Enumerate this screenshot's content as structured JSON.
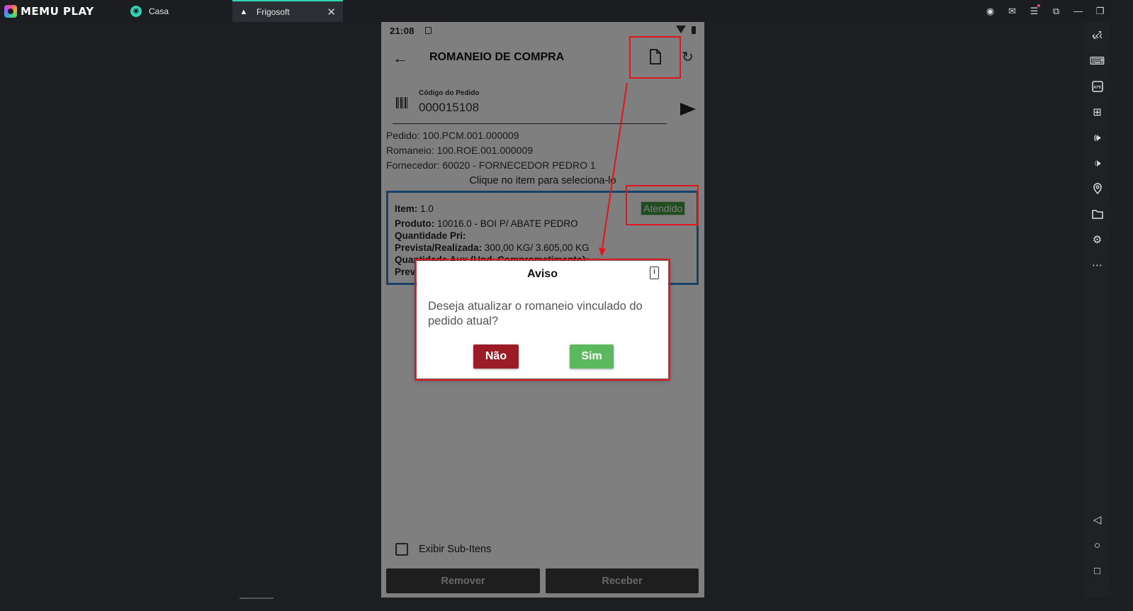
{
  "emulator": {
    "brand": "MEMU PLAY",
    "tabs": [
      {
        "label": "Casa"
      },
      {
        "label": "Frigosoft"
      }
    ],
    "accent_color": "#2fd3b4"
  },
  "phone": {
    "status_time": "21:08",
    "app_title": "ROMANEIO DE COMPRA",
    "code_field": {
      "label": "Código do Pedido",
      "value": "000015108"
    },
    "info": {
      "pedido": "Pedido: 100.PCM.001.000009",
      "romaneio": "Romaneio: 100.ROE.001.000009",
      "fornecedor": "Fornecedor: 60020 - FORNECEDOR PEDRO 1"
    },
    "hint": "Clique no item para seleciona-lo",
    "item": {
      "item_label": "Item:",
      "item_value": " 1.0",
      "produto_label": "Produto:",
      "produto_value": " 10016.0 - BOI P/ ABATE PEDRO",
      "qtd_pri_label": "Quantidade Pri:",
      "prev_real_label": "Prevista/Realizada:",
      "prev_real_value": "  300,00 KG/ 3.605,00 KG",
      "qtd_aux_label": "Quantidade Aux (Und. Comprometimento):",
      "prev_label": "Prev",
      "status": "Atendido",
      "status_color": "#3f9a3e",
      "border_color": "#2f86d6"
    },
    "sub_items_label": "Exibir Sub-Itens",
    "buttons": {
      "remover": "Remover",
      "receber": "Receber"
    },
    "dialog": {
      "title": "Aviso",
      "message": "Deseja atualizar o romaneio vinculado do pedido atual?",
      "no_label": "Não",
      "yes_label": "Sim",
      "no_color": "#9b1c27",
      "yes_color": "#5cb85c"
    }
  },
  "annotation_color": "#e0161c"
}
